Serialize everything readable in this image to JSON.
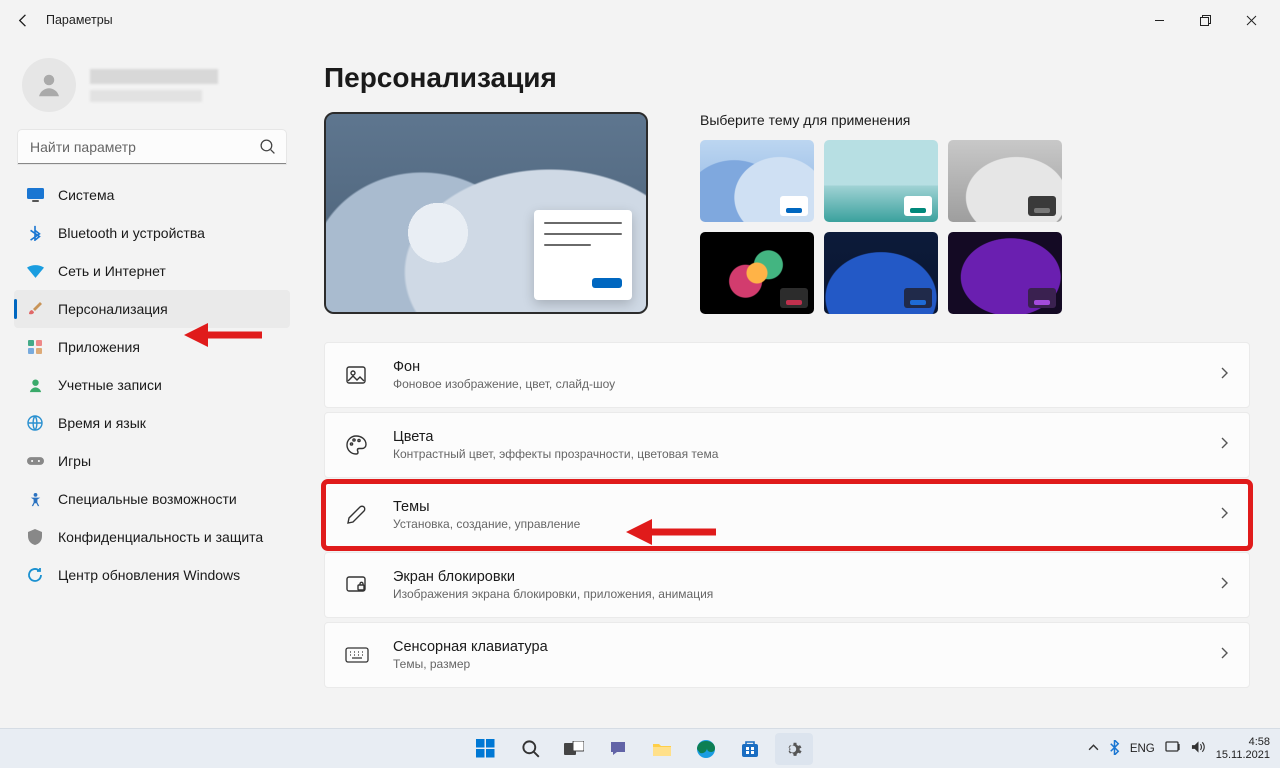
{
  "window": {
    "title": "Параметры"
  },
  "account": {
    "name": "",
    "email": ""
  },
  "search": {
    "placeholder": "Найти параметр"
  },
  "nav": {
    "items": [
      {
        "label": "Система"
      },
      {
        "label": "Bluetooth и устройства"
      },
      {
        "label": "Сеть и Интернет"
      },
      {
        "label": "Персонализация"
      },
      {
        "label": "Приложения"
      },
      {
        "label": "Учетные записи"
      },
      {
        "label": "Время и язык"
      },
      {
        "label": "Игры"
      },
      {
        "label": "Специальные возможности"
      },
      {
        "label": "Конфиденциальность и защита"
      },
      {
        "label": "Центр обновления Windows"
      }
    ],
    "active_index": 3
  },
  "page": {
    "title": "Персонализация",
    "themes_heading": "Выберите тему для применения",
    "options": [
      {
        "title": "Фон",
        "desc": "Фоновое изображение, цвет, слайд-шоу"
      },
      {
        "title": "Цвета",
        "desc": "Контрастный цвет, эффекты прозрачности, цветовая тема"
      },
      {
        "title": "Темы",
        "desc": "Установка, создание, управление"
      },
      {
        "title": "Экран блокировки",
        "desc": "Изображения экрана блокировки, приложения, анимация"
      },
      {
        "title": "Сенсорная клавиатура",
        "desc": "Темы, размер"
      }
    ]
  },
  "taskbar": {
    "lang": "ENG",
    "time": "4:58",
    "date": "15.11.2021"
  },
  "annotations": {
    "highlight_option_index": 2
  }
}
